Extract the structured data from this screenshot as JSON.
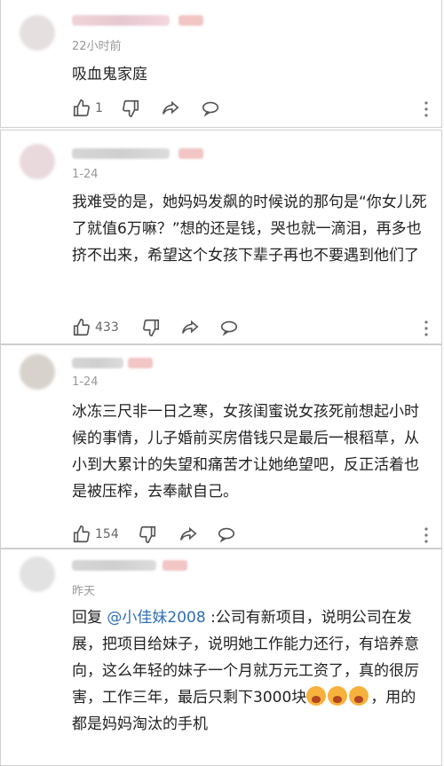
{
  "comments": [
    {
      "time": "22小时前",
      "content": "吸血鬼家庭",
      "likes": "1",
      "shares": ""
    },
    {
      "time": "1-24",
      "content": "我难受的是，她妈妈发飙的时候说的那句是“你女儿死了就值6万嘛？”想的还是钱，哭也就一滴泪，再多也挤不出来，希望这个女孩下辈子再也不要遇到他们了",
      "likes": "433"
    },
    {
      "time": "1-24",
      "content": "冰冻三尺非一日之寒，女孩闺蜜说女孩死前想起小时候的事情，儿子婚前买房借钱只是最后一根稻草，从小到大累计的失望和痛苦才让她绝望吧，反正活着也是被压榨，去奉献自己。",
      "likes": "154"
    },
    {
      "time": "昨天",
      "reply_prefix": "回复 ",
      "mention": "@小佳妹2008",
      "reply_text": " :公司有新项目，说明公司在发展，把项目给妹子，说明她工作能力还行，有培养意向，这么年轻的妹子一个月就万元工资了，真的很厉害，工作三年，最后只剩下3000块",
      "reply_tail": "，用的都是妈妈淘汰的手机"
    }
  ],
  "icons": {
    "like": "thumbs-up-icon",
    "dislike": "thumbs-down-icon",
    "share": "share-arrow-icon",
    "reply": "speech-bubble-icon",
    "more": "more-vertical-icon",
    "emoji": "crying-face-icon"
  },
  "colors": {
    "text": "#222222",
    "muted": "#999999",
    "mention": "#2f6db5"
  }
}
